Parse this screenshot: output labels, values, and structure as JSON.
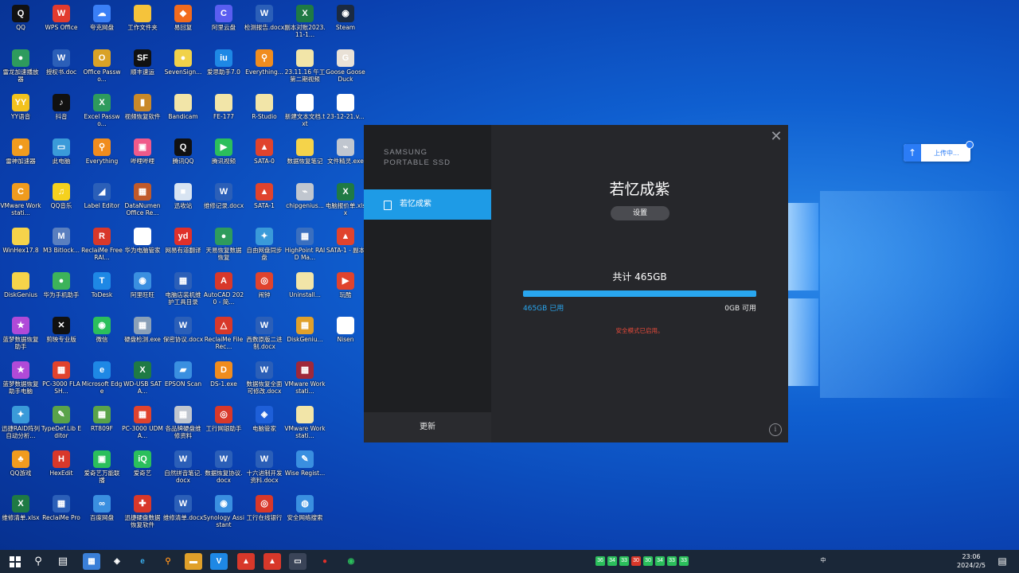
{
  "desktop": {
    "icons": [
      {
        "label": "QQ",
        "icon": "qq-icon",
        "color": "#111111",
        "glyph": "Q",
        "col": 0,
        "row": 0
      },
      {
        "label": "WPS Office",
        "icon": "wps-icon",
        "color": "#e23b2e",
        "glyph": "W",
        "col": 1,
        "row": 0
      },
      {
        "label": "夸克网盘",
        "icon": "quark-drive-icon",
        "color": "#3a7ff6",
        "glyph": "☁",
        "col": 2,
        "row": 0
      },
      {
        "label": "工作文件夹",
        "icon": "folder-icon",
        "color": "#f5c33b",
        "glyph": "",
        "col": 3,
        "row": 0
      },
      {
        "label": "易回复",
        "icon": "app-icon",
        "color": "#f26b1d",
        "glyph": "◆",
        "col": 4,
        "row": 0
      },
      {
        "label": "阿里云盘",
        "icon": "aliyun-drive-icon",
        "color": "#5a5ef0",
        "glyph": "C",
        "col": 5,
        "row": 0
      },
      {
        "label": "检测报告.docx",
        "icon": "word-doc-icon",
        "color": "#2b5fb8",
        "glyph": "W",
        "col": 6,
        "row": 0
      },
      {
        "label": "副本对账2023.11-1...",
        "icon": "excel-doc-icon",
        "color": "#1f7a44",
        "glyph": "X",
        "col": 7,
        "row": 0
      },
      {
        "label": "Steam",
        "icon": "steam-icon",
        "color": "#1b2a40",
        "glyph": "◉",
        "col": 8,
        "row": 0
      },
      {
        "label": "雷龙加速播放器",
        "icon": "app-icon",
        "color": "#2e9b5d",
        "glyph": "●",
        "col": 0,
        "row": 1
      },
      {
        "label": "授权书.doc",
        "icon": "word-doc-icon",
        "color": "#2b5fb8",
        "glyph": "W",
        "col": 1,
        "row": 1
      },
      {
        "label": "Office Passwo...",
        "icon": "office-password-icon",
        "color": "#d9a227",
        "glyph": "O",
        "col": 2,
        "row": 1
      },
      {
        "label": "顺丰速运",
        "icon": "sf-express-icon",
        "color": "#111111",
        "glyph": "SF",
        "col": 3,
        "row": 1
      },
      {
        "label": "SevenSign...",
        "icon": "app-icon",
        "color": "#f1d24a",
        "glyph": "●",
        "col": 4,
        "row": 1
      },
      {
        "label": "爱思助手7.0",
        "icon": "i4-icon",
        "color": "#1e88e5",
        "glyph": "iu",
        "col": 5,
        "row": 1
      },
      {
        "label": "Everything...",
        "icon": "everything-icon",
        "color": "#f08c1e",
        "glyph": "⚲",
        "col": 6,
        "row": 1
      },
      {
        "label": "23.11.16 午工第二期视频",
        "icon": "file-icon",
        "color": "#f2e5a8",
        "glyph": "",
        "col": 7,
        "row": 1
      },
      {
        "label": "Goose Goose Duck",
        "icon": "goose-icon",
        "color": "#e9e1d6",
        "glyph": "G",
        "col": 8,
        "row": 1
      },
      {
        "label": "YY语音",
        "icon": "yy-icon",
        "color": "#f2c21e",
        "glyph": "YY",
        "col": 0,
        "row": 2
      },
      {
        "label": "抖音",
        "icon": "douyin-icon",
        "color": "#111111",
        "glyph": "♪",
        "col": 1,
        "row": 2
      },
      {
        "label": "Excel Passwo...",
        "icon": "excel-password-icon",
        "color": "#2e9b5d",
        "glyph": "X",
        "col": 2,
        "row": 2
      },
      {
        "label": "视频恢复软件",
        "icon": "app-icon",
        "color": "#c9892a",
        "glyph": "▮",
        "col": 3,
        "row": 2
      },
      {
        "label": "Bandicam",
        "icon": "file-icon",
        "color": "#f2e5a8",
        "glyph": "",
        "col": 4,
        "row": 2
      },
      {
        "label": "FE-177",
        "icon": "file-icon",
        "color": "#f2e5a8",
        "glyph": "",
        "col": 5,
        "row": 2
      },
      {
        "label": "R-Studio",
        "icon": "file-icon",
        "color": "#f2e5a8",
        "glyph": "",
        "col": 6,
        "row": 2
      },
      {
        "label": "新建文本文档.txt",
        "icon": "text-file-icon",
        "color": "#ffffff",
        "glyph": "",
        "col": 7,
        "row": 2
      },
      {
        "label": "23-12-21.v...",
        "icon": "file-icon",
        "color": "#ffffff",
        "glyph": "",
        "col": 8,
        "row": 2
      },
      {
        "label": "雷神加速器",
        "icon": "app-icon",
        "color": "#f09b1e",
        "glyph": "●",
        "col": 0,
        "row": 3
      },
      {
        "label": "此电脑",
        "icon": "this-pc-icon",
        "color": "#3a9ad9",
        "glyph": "▭",
        "col": 1,
        "row": 3
      },
      {
        "label": "Everything",
        "icon": "everything-icon",
        "color": "#f08c1e",
        "glyph": "⚲",
        "col": 2,
        "row": 3
      },
      {
        "label": "哔哩哔哩",
        "icon": "bilibili-icon",
        "color": "#f05a8a",
        "glyph": "▣",
        "col": 3,
        "row": 3
      },
      {
        "label": "腾讯QQ",
        "icon": "qq-icon",
        "color": "#111111",
        "glyph": "Q",
        "col": 4,
        "row": 3
      },
      {
        "label": "腾讯视频",
        "icon": "tencent-video-icon",
        "color": "#2bbf5c",
        "glyph": "▶",
        "col": 5,
        "row": 3
      },
      {
        "label": "SATA-0",
        "icon": "app-icon",
        "color": "#e0432d",
        "glyph": "▲",
        "col": 6,
        "row": 3
      },
      {
        "label": "数据恢复笔记",
        "icon": "file-icon",
        "color": "#f5d34a",
        "glyph": "",
        "col": 7,
        "row": 3
      },
      {
        "label": "文件精灵.exe",
        "icon": "exe-icon",
        "color": "#c0c6cf",
        "glyph": "⌁",
        "col": 8,
        "row": 3
      },
      {
        "label": "VMware Workstati...",
        "icon": "vmware-icon",
        "color": "#f09b1e",
        "glyph": "C",
        "col": 0,
        "row": 4
      },
      {
        "label": "QQ音乐",
        "icon": "qq-music-icon",
        "color": "#f5d11e",
        "glyph": "♫",
        "col": 1,
        "row": 4
      },
      {
        "label": "Label Editor",
        "icon": "label-editor-icon",
        "color": "#2b5fb8",
        "glyph": "◢",
        "col": 2,
        "row": 4
      },
      {
        "label": "DataNumen Office Re...",
        "icon": "datanumen-icon",
        "color": "#c05a2b",
        "glyph": "▦",
        "col": 3,
        "row": 4
      },
      {
        "label": "迅收站",
        "icon": "app-icon",
        "color": "#d8e4f2",
        "glyph": "■",
        "col": 4,
        "row": 4
      },
      {
        "label": "维修记录.docx",
        "icon": "word-doc-icon",
        "color": "#2b5fb8",
        "glyph": "W",
        "col": 5,
        "row": 4
      },
      {
        "label": "SATA-1",
        "icon": "app-icon",
        "color": "#e0432d",
        "glyph": "▲",
        "col": 6,
        "row": 4
      },
      {
        "label": "chipgenius...",
        "icon": "usb-icon",
        "color": "#c0c6cf",
        "glyph": "⌁",
        "col": 7,
        "row": 4
      },
      {
        "label": "电脑报价单.xlsx",
        "icon": "excel-doc-icon",
        "color": "#1f7a44",
        "glyph": "X",
        "col": 8,
        "row": 4
      },
      {
        "label": "WinHex17.8",
        "icon": "file-icon",
        "color": "#f5d34a",
        "glyph": "",
        "col": 0,
        "row": 5
      },
      {
        "label": "M3 Bitlock...",
        "icon": "m3-bitlocker-icon",
        "color": "#5a7fbf",
        "glyph": "M",
        "col": 1,
        "row": 5
      },
      {
        "label": "ReclaiMe Free RAI...",
        "icon": "reclaime-icon",
        "color": "#d8382a",
        "glyph": "R",
        "col": 2,
        "row": 5
      },
      {
        "label": "华为电脑管家",
        "icon": "huawei-pc-manager-icon",
        "color": "#ffffff",
        "glyph": "M",
        "col": 3,
        "row": 5
      },
      {
        "label": "网易有道翻译",
        "icon": "youdao-icon",
        "color": "#e0302a",
        "glyph": "yd",
        "col": 4,
        "row": 5
      },
      {
        "label": "天易恢复数据恢复",
        "icon": "app-icon",
        "color": "#2e9b5d",
        "glyph": "●",
        "col": 5,
        "row": 5
      },
      {
        "label": "自由网盘同步盘",
        "icon": "sync-drive-icon",
        "color": "#3a9ad9",
        "glyph": "✦",
        "col": 6,
        "row": 5
      },
      {
        "label": "HighPoint RAID Ma...",
        "icon": "highpoint-icon",
        "color": "#3a6fbf",
        "glyph": "▦",
        "col": 7,
        "row": 5
      },
      {
        "label": "SATA-1 - 副本",
        "icon": "app-icon",
        "color": "#e0432d",
        "glyph": "▲",
        "col": 8,
        "row": 5
      },
      {
        "label": "DiskGenius",
        "icon": "file-icon",
        "color": "#f5d34a",
        "glyph": "",
        "col": 0,
        "row": 6
      },
      {
        "label": "华为手机助手",
        "icon": "huawei-hisuite-icon",
        "color": "#3db35a",
        "glyph": "●",
        "col": 1,
        "row": 6
      },
      {
        "label": "ToDesk",
        "icon": "todesk-icon",
        "color": "#1e88e5",
        "glyph": "T",
        "col": 2,
        "row": 6
      },
      {
        "label": "阿里旺旺",
        "icon": "aliwangwang-icon",
        "color": "#3a8fe0",
        "glyph": "◉",
        "col": 3,
        "row": 6
      },
      {
        "label": "电脑店装机维护工具目录",
        "icon": "app-icon",
        "color": "#2b5fb8",
        "glyph": "▦",
        "col": 4,
        "row": 6
      },
      {
        "label": "AutoCAD 2020 - 简...",
        "icon": "autocad-icon",
        "color": "#d8382a",
        "glyph": "A",
        "col": 5,
        "row": 6
      },
      {
        "label": "闹钟",
        "icon": "app-icon",
        "color": "#e0432d",
        "glyph": "◎",
        "col": 6,
        "row": 6
      },
      {
        "label": "Uninstall...",
        "icon": "uninstall-icon",
        "color": "#f2e5a8",
        "glyph": "",
        "col": 7,
        "row": 6
      },
      {
        "label": "玩酷",
        "icon": "app-icon",
        "color": "#e0432d",
        "glyph": "▶",
        "col": 8,
        "row": 6
      },
      {
        "label": "蓝梦数据恢复助手",
        "icon": "app-icon",
        "color": "#b04ad8",
        "glyph": "★",
        "col": 0,
        "row": 7
      },
      {
        "label": "剪映专业版",
        "icon": "capcut-icon",
        "color": "#111111",
        "glyph": "✕",
        "col": 1,
        "row": 7
      },
      {
        "label": "微信",
        "icon": "wechat-icon",
        "color": "#2bbf5c",
        "glyph": "◉",
        "col": 2,
        "row": 7
      },
      {
        "label": "硬盘检测.exe",
        "icon": "exe-icon",
        "color": "#8aa0b8",
        "glyph": "▦",
        "col": 3,
        "row": 7
      },
      {
        "label": "保密协议.docx",
        "icon": "word-doc-icon",
        "color": "#2b5fb8",
        "glyph": "W",
        "col": 4,
        "row": 7
      },
      {
        "label": "ReclaiMe File Rec...",
        "icon": "reclaime-icon",
        "color": "#d8382a",
        "glyph": "△",
        "col": 5,
        "row": 7
      },
      {
        "label": "西数原版二进制.docx",
        "icon": "word-doc-icon",
        "color": "#2b5fb8",
        "glyph": "W",
        "col": 6,
        "row": 7
      },
      {
        "label": "DiskGeniu...",
        "icon": "diskgenius-icon",
        "color": "#e0a02a",
        "glyph": "▦",
        "col": 7,
        "row": 7
      },
      {
        "label": "Nisen",
        "icon": "file-icon",
        "color": "#ffffff",
        "glyph": "",
        "col": 8,
        "row": 7
      },
      {
        "label": "蓝梦数据恢复助手电脑",
        "icon": "app-icon",
        "color": "#b04ad8",
        "glyph": "★",
        "col": 0,
        "row": 8
      },
      {
        "label": "PC-3000 FLASH...",
        "icon": "pc3000-icon",
        "color": "#e0432d",
        "glyph": "▦",
        "col": 1,
        "row": 8
      },
      {
        "label": "Microsoft Edge",
        "icon": "edge-icon",
        "color": "#1e88e5",
        "glyph": "e",
        "col": 2,
        "row": 8
      },
      {
        "label": "WD-USB SATA...",
        "icon": "excel-doc-icon",
        "color": "#1f7a44",
        "glyph": "X",
        "col": 3,
        "row": 8
      },
      {
        "label": "EPSON Scan",
        "icon": "epson-scan-icon",
        "color": "#3a8fe0",
        "glyph": "▰",
        "col": 4,
        "row": 8
      },
      {
        "label": "DS-1.exe",
        "icon": "exe-icon",
        "color": "#f08c1e",
        "glyph": "D",
        "col": 5,
        "row": 8
      },
      {
        "label": "数据恢复全面可修改.docx",
        "icon": "word-doc-icon",
        "color": "#2b5fb8",
        "glyph": "W",
        "col": 6,
        "row": 8
      },
      {
        "label": "VMware Workstati...",
        "icon": "winrar-icon",
        "color": "#a0283a",
        "glyph": "▦",
        "col": 7,
        "row": 8
      },
      {
        "label": "迅捷RAID阵列自动分析...",
        "icon": "app-icon",
        "color": "#3a9ad9",
        "glyph": "✦",
        "col": 0,
        "row": 9
      },
      {
        "label": "TypeDef.Lib Editor",
        "icon": "typedef-icon",
        "color": "#5aa34a",
        "glyph": "✎",
        "col": 1,
        "row": 9
      },
      {
        "label": "RT809F",
        "icon": "rt809f-icon",
        "color": "#5aa34a",
        "glyph": "▦",
        "col": 2,
        "row": 9
      },
      {
        "label": "PC-3000 UDMA...",
        "icon": "pc3000-icon",
        "color": "#e0432d",
        "glyph": "▦",
        "col": 3,
        "row": 9
      },
      {
        "label": "各品牌硬盘维修资料",
        "icon": "app-icon",
        "color": "#c0c6cf",
        "glyph": "▦",
        "col": 4,
        "row": 9
      },
      {
        "label": "工行网银助手",
        "icon": "icbc-icon",
        "color": "#d8382a",
        "glyph": "◎",
        "col": 5,
        "row": 9
      },
      {
        "label": "电脑管家",
        "icon": "pc-manager-icon",
        "color": "#1e5fd8",
        "glyph": "◈",
        "col": 6,
        "row": 9
      },
      {
        "label": "VMware Workstati...",
        "icon": "file-icon",
        "color": "#f2e5a8",
        "glyph": "",
        "col": 7,
        "row": 9
      },
      {
        "label": "QQ游戏",
        "icon": "qq-game-icon",
        "color": "#f09b1e",
        "glyph": "♣",
        "col": 0,
        "row": 10
      },
      {
        "label": "HexEdit",
        "icon": "hexedit-icon",
        "color": "#d8382a",
        "glyph": "H",
        "col": 1,
        "row": 10
      },
      {
        "label": "爱奇艺万能联播",
        "icon": "iqiyi-player-icon",
        "color": "#2bbf5c",
        "glyph": "▣",
        "col": 2,
        "row": 10
      },
      {
        "label": "爱奇艺",
        "icon": "iqiyi-icon",
        "color": "#2bbf5c",
        "glyph": "iQ",
        "col": 3,
        "row": 10
      },
      {
        "label": "自然拼音笔记.docx",
        "icon": "word-doc-icon",
        "color": "#2b5fb8",
        "glyph": "W",
        "col": 4,
        "row": 10
      },
      {
        "label": "数据恢复协议.docx",
        "icon": "word-doc-icon",
        "color": "#2b5fb8",
        "glyph": "W",
        "col": 5,
        "row": 10
      },
      {
        "label": "十六进制开发资料.docx",
        "icon": "word-doc-icon",
        "color": "#2b5fb8",
        "glyph": "W",
        "col": 6,
        "row": 10
      },
      {
        "label": "Wise Regist...",
        "icon": "wise-registry-icon",
        "color": "#3a8fe0",
        "glyph": "✎",
        "col": 7,
        "row": 10
      },
      {
        "label": "维修清单.xlsx",
        "icon": "excel-doc-icon",
        "color": "#1f7a44",
        "glyph": "X",
        "col": 0,
        "row": 11
      },
      {
        "label": "ReclaiMe Pro",
        "icon": "reclaime-icon",
        "color": "#2b5fb8",
        "glyph": "▦",
        "col": 1,
        "row": 11
      },
      {
        "label": "百度网盘",
        "icon": "baidu-netdisk-icon",
        "color": "#3a8fe0",
        "glyph": "∞",
        "col": 2,
        "row": 11
      },
      {
        "label": "迅捷硬盘数据恢复软件",
        "icon": "app-icon",
        "color": "#d8382a",
        "glyph": "✚",
        "col": 3,
        "row": 11
      },
      {
        "label": "维修清单.docx",
        "icon": "word-doc-icon",
        "color": "#2b5fb8",
        "glyph": "W",
        "col": 4,
        "row": 11
      },
      {
        "label": "Synology Assistant",
        "icon": "synology-icon",
        "color": "#3a8fe0",
        "glyph": "◉",
        "col": 5,
        "row": 11
      },
      {
        "label": "工行在线银行",
        "icon": "icbc-icon",
        "color": "#d8382a",
        "glyph": "◎",
        "col": 6,
        "row": 11
      },
      {
        "label": "安全网络搜索",
        "icon": "app-icon",
        "color": "#3a8fe0",
        "glyph": "◍",
        "col": 7,
        "row": 11
      }
    ]
  },
  "ssd_window": {
    "brand_line1": "SAMSUNG",
    "brand_line2": "PORTABLE SSD",
    "drive_label": "若忆成紫",
    "device_name": "若忆成紫",
    "settings_label": "设置",
    "total_label": "共计 465GB",
    "used_label": "465GB 已用",
    "available_label": "0GB 可用",
    "used_fraction": 1.0,
    "secure_message": "安全模式已启用。",
    "update_label": "更新",
    "close_glyph": "✕",
    "info_glyph": "i"
  },
  "upload_widget": {
    "label": "上传中..."
  },
  "taskbar": {
    "clock_time": "23:06",
    "clock_date": "2024/2/5",
    "apps": [
      "start",
      "search",
      "task-view",
      "file-manager",
      "app",
      "edge",
      "everything",
      "folder",
      "vmware-v",
      "app-red",
      "app-red2",
      "ssd-app",
      "recorder",
      "wechat"
    ],
    "tray": [
      "36",
      "34",
      "33",
      "30",
      "30",
      "34",
      "33",
      "33",
      "中"
    ]
  },
  "colors": {
    "accent": "#1e9be6",
    "warning": "#e84a3a"
  }
}
